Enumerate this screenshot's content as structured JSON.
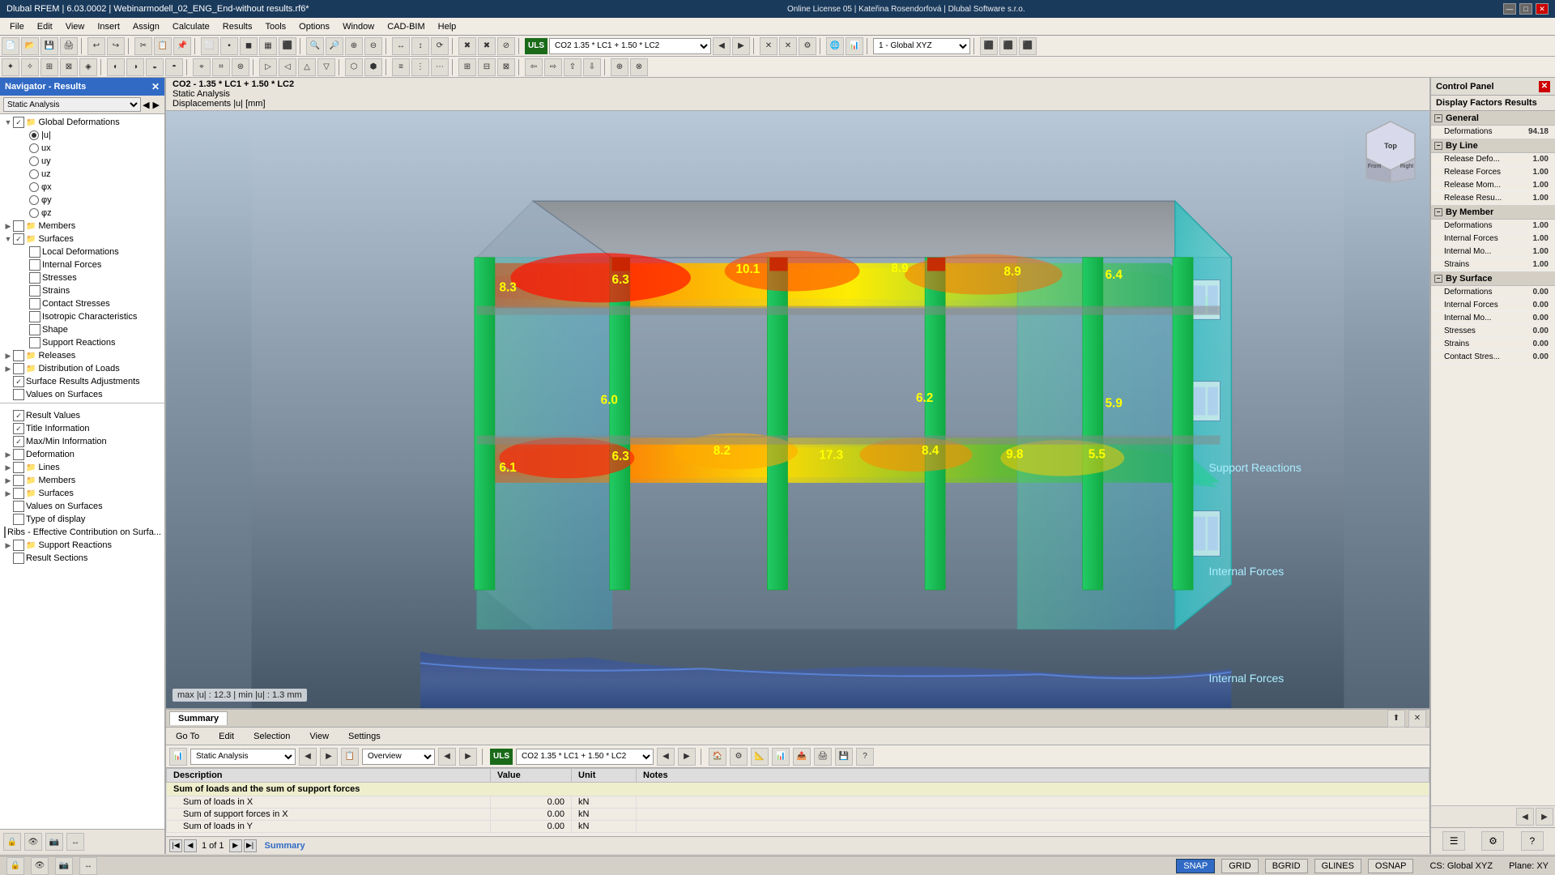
{
  "titlebar": {
    "title": "Dlubal RFEM | 6.03.0002 | Webinarmodell_02_ENG_End-without results.rf6*",
    "online_info": "Online License 05 | Kateřina Rosendorfová | Dlubal Software s.r.o.",
    "min_label": "—",
    "max_label": "□",
    "close_label": "✕"
  },
  "menubar": {
    "items": [
      "File",
      "Edit",
      "View",
      "Insert",
      "Assign",
      "Calculate",
      "Results",
      "Tools",
      "Options",
      "Window",
      "CAD-BIM",
      "Help"
    ]
  },
  "navigator": {
    "title": "Navigator - Results",
    "filter": "Static Analysis",
    "tree": [
      {
        "indent": 0,
        "type": "check",
        "checked": true,
        "icon": "folder",
        "label": "Global Deformations",
        "expander": "▼"
      },
      {
        "indent": 1,
        "type": "radio",
        "checked": true,
        "label": "|u|"
      },
      {
        "indent": 1,
        "type": "radio",
        "checked": false,
        "label": "ux"
      },
      {
        "indent": 1,
        "type": "radio",
        "checked": false,
        "label": "uy"
      },
      {
        "indent": 1,
        "type": "radio",
        "checked": false,
        "label": "uz"
      },
      {
        "indent": 1,
        "type": "radio",
        "checked": false,
        "label": "φx"
      },
      {
        "indent": 1,
        "type": "radio",
        "checked": false,
        "label": "φy"
      },
      {
        "indent": 1,
        "type": "radio",
        "checked": false,
        "label": "φz"
      },
      {
        "indent": 0,
        "type": "check",
        "checked": false,
        "icon": "folder",
        "label": "Members",
        "expander": "▶"
      },
      {
        "indent": 0,
        "type": "check",
        "checked": true,
        "icon": "folder",
        "label": "Surfaces",
        "expander": "▼"
      },
      {
        "indent": 1,
        "type": "check",
        "checked": false,
        "icon": "item",
        "label": "Local Deformations"
      },
      {
        "indent": 1,
        "type": "check",
        "checked": false,
        "icon": "item",
        "label": "Internal Forces"
      },
      {
        "indent": 1,
        "type": "check",
        "checked": false,
        "icon": "item",
        "label": "Stresses"
      },
      {
        "indent": 1,
        "type": "check",
        "checked": false,
        "icon": "item",
        "label": "Strains"
      },
      {
        "indent": 1,
        "type": "check",
        "checked": false,
        "icon": "item",
        "label": "Contact Stresses"
      },
      {
        "indent": 1,
        "type": "check",
        "checked": false,
        "icon": "item",
        "label": "Isotropic Characteristics"
      },
      {
        "indent": 1,
        "type": "check",
        "checked": false,
        "icon": "item",
        "label": "Shape"
      },
      {
        "indent": 1,
        "type": "check",
        "checked": false,
        "icon": "item",
        "label": "Support Reactions"
      },
      {
        "indent": 0,
        "type": "check",
        "checked": false,
        "icon": "folder",
        "label": "Releases",
        "expander": "▶"
      },
      {
        "indent": 0,
        "type": "check",
        "checked": false,
        "icon": "folder",
        "label": "Distribution of Loads",
        "expander": "▶"
      },
      {
        "indent": 0,
        "type": "check",
        "checked": true,
        "icon": "item",
        "label": "Surface Results Adjustments"
      },
      {
        "indent": 0,
        "type": "check",
        "checked": false,
        "icon": "item",
        "label": "Values on Surfaces"
      },
      {
        "indent": 0,
        "type": "sep"
      },
      {
        "indent": 0,
        "type": "check",
        "checked": true,
        "icon": "item",
        "label": "Result Values"
      },
      {
        "indent": 0,
        "type": "check",
        "checked": true,
        "icon": "item",
        "label": "Title Information"
      },
      {
        "indent": 0,
        "type": "check",
        "checked": true,
        "icon": "item",
        "label": "Max/Min Information"
      },
      {
        "indent": 0,
        "type": "check",
        "checked": false,
        "icon": "item",
        "label": "Deformation",
        "expander": "▶"
      },
      {
        "indent": 0,
        "type": "check",
        "checked": false,
        "icon": "folder",
        "label": "Lines",
        "expander": "▶"
      },
      {
        "indent": 0,
        "type": "check",
        "checked": false,
        "icon": "folder",
        "label": "Members",
        "expander": "▶"
      },
      {
        "indent": 0,
        "type": "check",
        "checked": false,
        "icon": "folder",
        "label": "Surfaces",
        "expander": "▶"
      },
      {
        "indent": 0,
        "type": "check",
        "checked": false,
        "icon": "item",
        "label": "Values on Surfaces"
      },
      {
        "indent": 0,
        "type": "check",
        "checked": false,
        "icon": "item",
        "label": "Type of display"
      },
      {
        "indent": 0,
        "type": "check",
        "checked": false,
        "icon": "item",
        "label": "Ribs - Effective Contribution on Surfa..."
      },
      {
        "indent": 0,
        "type": "check",
        "checked": false,
        "icon": "folder",
        "label": "Support Reactions",
        "expander": "▶"
      },
      {
        "indent": 0,
        "type": "check",
        "checked": false,
        "icon": "item",
        "label": "Result Sections"
      }
    ]
  },
  "viewport": {
    "combo_line1": "CO2 - 1.35 * LC1 + 1.50 * LC2",
    "line1": "CO2 - 1.35 * LC1 + 1.50 * LC2",
    "line2": "Static Analysis",
    "line3": "Displacements |u| [mm]",
    "label": "max |u| : 12.3 | min |u| : 1.3 mm",
    "uls_label": "ULS",
    "co2_label": "CO2",
    "combo_display": "1.35 * LC1 + 1.50 * LC2"
  },
  "control_panel": {
    "title": "Control Panel",
    "close_label": "✕",
    "subtitle": "Display Factors Results",
    "sections": {
      "general": {
        "label": "General",
        "rows": [
          {
            "name": "Deformations",
            "value": "94.18"
          }
        ]
      },
      "by_line": {
        "label": "By Line",
        "rows": [
          {
            "name": "Release Defo...",
            "value": "1.00"
          },
          {
            "name": "Release Forces",
            "value": "1.00"
          },
          {
            "name": "Release Mom...",
            "value": "1.00"
          },
          {
            "name": "Release Resu...",
            "value": "1.00"
          }
        ]
      },
      "by_member": {
        "label": "By Member",
        "rows": [
          {
            "name": "Deformations",
            "value": "1.00"
          },
          {
            "name": "Internal Forces",
            "value": "1.00"
          },
          {
            "name": "Internal Mo...",
            "value": "1.00"
          },
          {
            "name": "Strains",
            "value": "1.00"
          }
        ]
      },
      "by_surface": {
        "label": "By Surface",
        "rows": [
          {
            "name": "Deformations",
            "value": "0.00"
          },
          {
            "name": "Internal Forces",
            "value": "0.00"
          },
          {
            "name": "Internal Mo...",
            "value": "0.00"
          },
          {
            "name": "Stresses",
            "value": "0.00"
          },
          {
            "name": "Strains",
            "value": "0.00"
          },
          {
            "name": "Contact Stres...",
            "value": "0.00"
          }
        ]
      }
    }
  },
  "summary": {
    "tab_label": "Summary",
    "menu_items": [
      "Go To",
      "Edit",
      "Selection",
      "View",
      "Settings"
    ],
    "combo_analysis": "Static Analysis",
    "combo_overview": "Overview",
    "uls_label": "ULS",
    "co2_label": "CO2",
    "combo_display2": "1.35 * LC1 + 1.50 * LC2",
    "table": {
      "headers": [
        "Description",
        "Value",
        "Unit",
        "Notes"
      ],
      "section": "Sum of loads and the sum of support forces",
      "rows": [
        {
          "desc": "Sum of loads in X",
          "value": "0.00",
          "unit": "kN",
          "notes": ""
        },
        {
          "desc": "Sum of support forces in X",
          "value": "0.00",
          "unit": "kN",
          "notes": ""
        },
        {
          "desc": "Sum of loads in Y",
          "value": "0.00",
          "unit": "kN",
          "notes": ""
        }
      ]
    },
    "footer": {
      "page_info": "1 of 1",
      "summary_label": "Summary"
    }
  },
  "statusbar": {
    "left_icons": [
      "🔒",
      "👁",
      "📹",
      "⇢"
    ],
    "buttons": [
      "SNAP",
      "GRID",
      "BGRID",
      "GLINES",
      "OSNAP"
    ],
    "active_buttons": [
      "SNAP"
    ],
    "cs_label": "CS: Global XYZ",
    "plane_label": "Plane: XY"
  },
  "toolbar1": {
    "items": [
      "📁",
      "💾",
      "🖨",
      "⎌",
      "↩",
      "↪",
      "✂",
      "📋",
      "🗑"
    ]
  },
  "numbers": {
    "val_83": "8.3",
    "val_63a": "6.3",
    "val_101": "10.1",
    "val_89a": "8.9",
    "val_89b": "8.9",
    "val_64": "6.4",
    "val_63b": "6.3",
    "val_82": "8.2",
    "val_173": "17.3",
    "val_84": "8.4",
    "val_98": "9.8",
    "val_60": "6.0",
    "val_55": "5.5",
    "val_62": "6.2",
    "val_59": "5.9",
    "val_61": "6.1"
  }
}
